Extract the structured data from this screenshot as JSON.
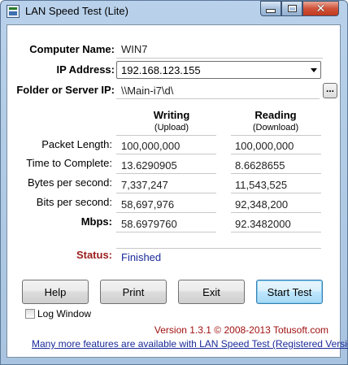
{
  "window": {
    "title": "LAN Speed Test (Lite)"
  },
  "captions": {
    "minimize": "minimize-icon",
    "maximize": "maximize-icon",
    "close": "close-icon"
  },
  "form": {
    "computer_name_label": "Computer Name:",
    "computer_name": "WIN7",
    "ip_label": "IP Address:",
    "ip_value": "192.168.123.155",
    "folder_label": "Folder or Server IP:",
    "folder_value": "\\\\Main-i7\\d\\",
    "browse_label": "..."
  },
  "results": {
    "writing_title": "Writing",
    "writing_sub": "(Upload)",
    "reading_title": "Reading",
    "reading_sub": "(Download)",
    "rows": [
      {
        "label": "Packet Length:",
        "writing": "100,000,000",
        "reading": "100,000,000"
      },
      {
        "label": "Time to Complete:",
        "writing": "13.6290905",
        "reading": "8.6628655"
      },
      {
        "label": "Bytes per second:",
        "writing": "7,337,247",
        "reading": "11,543,525"
      },
      {
        "label": "Bits per second:",
        "writing": "58,697,976",
        "reading": "92,348,200"
      },
      {
        "label": "Mbps:",
        "writing": "58.6979760",
        "reading": "92.3482000"
      }
    ]
  },
  "status": {
    "label": "Status:",
    "value": "Finished",
    "label_color": "#9b1c1c",
    "value_color": "#1a2a9a"
  },
  "buttons": {
    "help": "Help",
    "print": "Print",
    "exit": "Exit",
    "start": "Start Test"
  },
  "log_window": {
    "label": "Log Window",
    "checked": false
  },
  "footer": {
    "version": "Version 1.3.1 © 2008-2013 Totusoft.com",
    "promo": "Many more features are available with LAN Speed Test (Registered Version)"
  }
}
